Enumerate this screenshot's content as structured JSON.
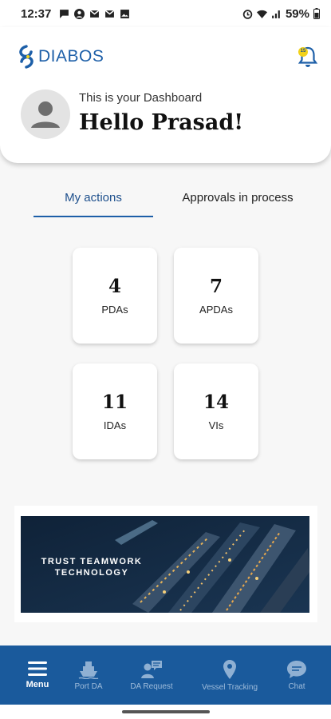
{
  "status_bar": {
    "time": "12:37",
    "battery": "59%",
    "left_icons": [
      "chat-bubble-icon",
      "account-circle-icon",
      "gmail-icon",
      "gmail-icon",
      "image-icon"
    ],
    "right_icons": [
      "alarm-icon",
      "wifi-icon",
      "signal-icon",
      "battery-icon"
    ]
  },
  "header": {
    "logo_text": "DIABOS",
    "notification_badge": "15",
    "subtitle": "This is your Dashboard",
    "greeting": "Hello Prasad!"
  },
  "tabs": [
    {
      "label": "My actions",
      "active": true
    },
    {
      "label": "Approvals in process",
      "active": false
    }
  ],
  "cards": [
    {
      "count": "4",
      "label": "PDAs"
    },
    {
      "count": "7",
      "label": "APDAs"
    },
    {
      "count": "11",
      "label": "IDAs"
    },
    {
      "count": "14",
      "label": "VIs"
    }
  ],
  "banner": {
    "line1": "TRUST  TEAMWORK",
    "line2": "TECHNOLOGY"
  },
  "bottom_nav": [
    {
      "label": "Menu",
      "icon": "menu-icon",
      "active": true
    },
    {
      "label": "Port DA",
      "icon": "ship-icon",
      "active": false
    },
    {
      "label": "DA Request",
      "icon": "user-request-icon",
      "active": false
    },
    {
      "label": "Vessel Tracking",
      "icon": "location-pin-icon",
      "active": false
    },
    {
      "label": "Chat",
      "icon": "chat-icon",
      "active": false
    }
  ],
  "colors": {
    "brand_blue": "#1d5fa8",
    "nav_bg": "#1a5a9c",
    "badge_yellow": "#f2d21b"
  }
}
